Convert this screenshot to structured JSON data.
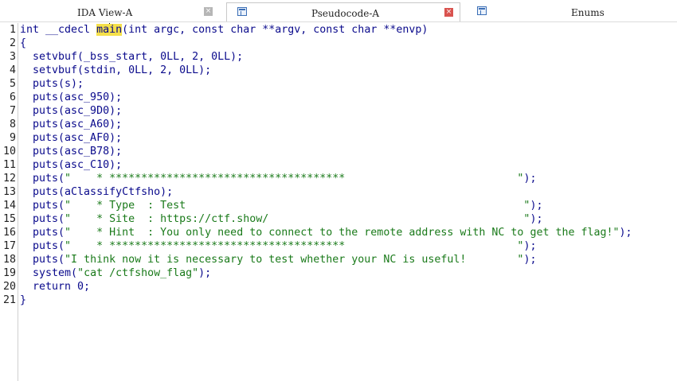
{
  "tabs": [
    {
      "label": "IDA View-A",
      "active": false,
      "icon": "disassembly-icon",
      "close": "×"
    },
    {
      "label": "Pseudocode-A",
      "active": true,
      "icon": "pseudocode-icon",
      "close": "×"
    },
    {
      "label": "Enums",
      "active": false,
      "icon": "enums-icon"
    }
  ],
  "code": {
    "lines": [
      {
        "n": "1",
        "parts": [
          {
            "t": "int __cdecl "
          },
          {
            "t": "ma",
            "hl": true
          },
          {
            "t": "in",
            "hl": true,
            "caret": true
          },
          {
            "t": "(int argc, const char **argv, const char **envp)"
          }
        ]
      },
      {
        "n": "2",
        "parts": [
          {
            "t": "{"
          }
        ]
      },
      {
        "n": "3",
        "parts": [
          {
            "t": "  setvbuf(_bss_start, 0LL, 2, 0LL);"
          }
        ]
      },
      {
        "n": "4",
        "parts": [
          {
            "t": "  setvbuf(stdin, 0LL, 2, 0LL);"
          }
        ]
      },
      {
        "n": "5",
        "parts": [
          {
            "t": "  puts(s);"
          }
        ]
      },
      {
        "n": "6",
        "parts": [
          {
            "t": "  puts(asc_950);"
          }
        ]
      },
      {
        "n": "7",
        "parts": [
          {
            "t": "  puts(asc_9D0);"
          }
        ]
      },
      {
        "n": "8",
        "parts": [
          {
            "t": "  puts(asc_A60);"
          }
        ]
      },
      {
        "n": "9",
        "parts": [
          {
            "t": "  puts(asc_AF0);"
          }
        ]
      },
      {
        "n": "10",
        "parts": [
          {
            "t": "  puts(asc_B78);"
          }
        ]
      },
      {
        "n": "11",
        "parts": [
          {
            "t": "  puts(asc_C10);"
          }
        ]
      },
      {
        "n": "12",
        "parts": [
          {
            "t": "  puts("
          },
          {
            "t": "\"    * *************************************                           \"",
            "s": true
          },
          {
            "t": ");"
          }
        ]
      },
      {
        "n": "13",
        "parts": [
          {
            "t": "  puts(aClassifyCtfsho);"
          }
        ]
      },
      {
        "n": "14",
        "parts": [
          {
            "t": "  puts("
          },
          {
            "t": "\"    * Type  : Test                                                     \"",
            "s": true
          },
          {
            "t": ");"
          }
        ]
      },
      {
        "n": "15",
        "parts": [
          {
            "t": "  puts("
          },
          {
            "t": "\"    * Site  : https://ctf.show/                                        \"",
            "s": true
          },
          {
            "t": ");"
          }
        ]
      },
      {
        "n": "16",
        "parts": [
          {
            "t": "  puts("
          },
          {
            "t": "\"    * Hint  : You only need to connect to the remote address with NC to get the flag!\"",
            "s": true
          },
          {
            "t": ");"
          }
        ]
      },
      {
        "n": "17",
        "parts": [
          {
            "t": "  puts("
          },
          {
            "t": "\"    * *************************************                           \"",
            "s": true
          },
          {
            "t": ");"
          }
        ]
      },
      {
        "n": "18",
        "parts": [
          {
            "t": "  puts("
          },
          {
            "t": "\"I think now it is necessary to test whether your NC is useful!        \"",
            "s": true
          },
          {
            "t": ");"
          }
        ]
      },
      {
        "n": "19",
        "parts": [
          {
            "t": "  system("
          },
          {
            "t": "\"cat /ctfshow_flag\"",
            "s": true
          },
          {
            "t": ");"
          }
        ]
      },
      {
        "n": "20",
        "parts": [
          {
            "t": "  return 0;"
          }
        ]
      },
      {
        "n": "21",
        "parts": [
          {
            "t": "}"
          }
        ]
      }
    ]
  },
  "colors": {
    "code": "#0a0a8c",
    "string": "#1a7a1a",
    "highlight": "#f5e04a"
  }
}
